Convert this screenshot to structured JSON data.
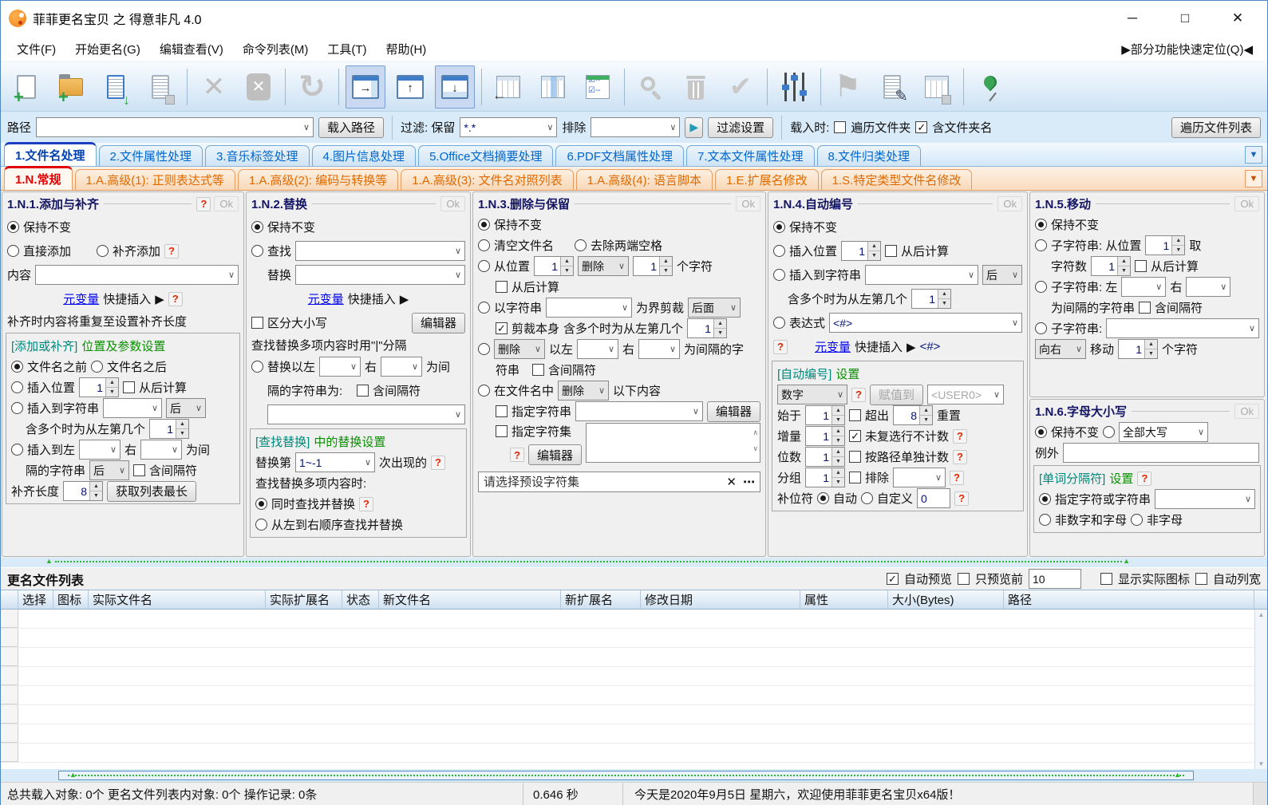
{
  "ui": {
    "q": "?",
    "ok": "Ok",
    "arrow": "▶",
    "x": "✕",
    "dots": "⋯",
    "play": "▶"
  },
  "window": {
    "title": "菲菲更名宝贝 之 得意非凡 4.0",
    "min": "─",
    "max": "□",
    "close": "✕"
  },
  "menu": {
    "items": [
      "文件(F)",
      "开始更名(G)",
      "编辑查看(V)",
      "命令列表(M)",
      "工具(T)",
      "帮助(H)"
    ],
    "quick": "▶部分功能快速定位(Q)◀"
  },
  "toolbar": {
    "groups": [
      [
        {
          "n": "add-files-icon",
          "t": "file-plus"
        },
        {
          "n": "add-folder-icon",
          "t": "folder-plus"
        },
        {
          "n": "load-list-icon",
          "t": "list-down"
        },
        {
          "n": "save-list-icon",
          "t": "list-save"
        }
      ],
      [
        {
          "n": "remove-item-icon",
          "t": "x"
        },
        {
          "n": "clear-list-icon",
          "t": "x-box"
        }
      ],
      [
        {
          "n": "refresh-icon",
          "t": "refresh"
        }
      ],
      [
        {
          "n": "panel-right-icon",
          "t": "panel-right",
          "sel": true
        },
        {
          "n": "panel-up-icon",
          "t": "panel-up"
        },
        {
          "n": "panel-down-icon",
          "t": "panel-down",
          "sel": true
        }
      ],
      [
        {
          "n": "layout-left-icon",
          "t": "grid-left"
        },
        {
          "n": "layout-columns-icon",
          "t": "grid-cols"
        },
        {
          "n": "layout-checklist-icon",
          "t": "grid-check"
        }
      ],
      [
        {
          "n": "search-icon",
          "t": "search"
        },
        {
          "n": "trash-icon",
          "t": "trash"
        },
        {
          "n": "apply-check-icon",
          "t": "check"
        }
      ],
      [
        {
          "n": "settings-sliders-icon",
          "t": "sliders"
        }
      ],
      [
        {
          "n": "flag-icon",
          "t": "flag"
        },
        {
          "n": "edit-list-icon",
          "t": "edit-list"
        },
        {
          "n": "export-table-icon",
          "t": "grid-save"
        }
      ],
      [
        {
          "n": "pin-icon",
          "t": "pin"
        }
      ]
    ]
  },
  "pathbar": {
    "path": "路径",
    "load": "载入路径",
    "filter": "过滤: 保留",
    "filter_val": "*.*",
    "excl": "排除",
    "settings": "过滤设置",
    "load_when": "载入时:",
    "traverse": "遍历文件夹",
    "incl_folder": "含文件夹名",
    "traverse_list": "遍历文件列表"
  },
  "tabs_main": {
    "active": 0,
    "items": [
      "1.文件名处理",
      "2.文件属性处理",
      "3.音乐标签处理",
      "4.图片信息处理",
      "5.Office文档摘要处理",
      "6.PDF文档属性处理",
      "7.文本文件属性处理",
      "8.文件归类处理"
    ]
  },
  "tabs_sub": {
    "active": 0,
    "items": [
      "1.N.常规",
      "1.A.高级(1): 正则表达式等",
      "1.A.高级(2): 编码与转换等",
      "1.A.高级(3): 文件名对照列表",
      "1.A.高级(4): 语言脚本",
      "1.E.扩展名修改",
      "1.S.特定类型文件名修改"
    ]
  },
  "p1": {
    "title": "1.N.1.添加与补齐",
    "keep": "保持不变",
    "direct_add": "直接添加",
    "pad_add": "补齐添加",
    "content": "内容",
    "meta": "元变量",
    "quick": "快捷插入",
    "note": "补齐时内容将重复至设置补齐长度",
    "group_b": "[添加或补齐]",
    "group_t": "位置及参数设置",
    "before_name": "文件名之前",
    "after_name": "文件名之后",
    "insert_pos": "插入位置",
    "pos_val": "1",
    "from_end": "从后计算",
    "insert_to_str": "插入到字符串",
    "after_opt": "后",
    "multi_hint": "含多个时为从左第几个",
    "multi_val": "1",
    "insert_l": "插入到左",
    "right": "右",
    "wei_jian": "为间",
    "sep_str": "隔的字符串",
    "incl_sep": "含间隔符",
    "pad_len": "补齐长度",
    "pad_val": "8",
    "get_longest": "获取列表最长"
  },
  "p2": {
    "title": "1.N.2.替换",
    "keep": "保持不变",
    "find": "查找",
    "replace": "替换",
    "meta": "元变量",
    "quick": "快捷插入",
    "case_sensitive": "区分大小写",
    "editor": "编辑器",
    "multi_note": "查找替换多项内容时用\"|\"分隔",
    "repl_l": "替换以左",
    "right": "右",
    "wei_jian": "为间",
    "sep_line": "隔的字符串为:",
    "incl_sep": "含间隔符",
    "group_b": "[查找替换]",
    "group_t": "中的替换设置",
    "nth": "替换第",
    "nth_val": "1~-1",
    "nth_suf": "次出现的",
    "multi_when": "查找替换多项内容时:",
    "simul": "同时查找并替换",
    "seq": "从左到右顺序查找并替换"
  },
  "p3": {
    "title": "1.N.3.删除与保留",
    "keep": "保持不变",
    "clear_name": "清空文件名",
    "trim": "去除两端空格",
    "from_pos": "从位置",
    "pos_val": "1",
    "del_opt": "删除",
    "cnt_val": "1",
    "chars": "个字符",
    "from_end": "从后计算",
    "by_str": "以字符串",
    "bound": "为界剪裁",
    "back_opt": "后面",
    "cut_self": "剪裁本身",
    "multi_hint": "含多个时为从左第几个",
    "multi_val": "1",
    "del_opt2": "删除",
    "between_l": "以左",
    "right": "右",
    "sep_suf": "为间隔的字",
    "str_cont": "符串",
    "incl_sep": "含间隔符",
    "in_name": "在文件名中",
    "del_opt3": "删除",
    "following": "以下内容",
    "spec_str": "指定字符串",
    "editor": "编辑器",
    "spec_set": "指定字符集",
    "editor2": "编辑器",
    "preset": "请选择预设字符集"
  },
  "p4": {
    "title": "1.N.4.自动编号",
    "keep": "保持不变",
    "insert_pos": "插入位置",
    "pos_val": "1",
    "from_end": "从后计算",
    "insert_to_str": "插入到字符串",
    "after_opt": "后",
    "multi_hint": "含多个时为从左第几个",
    "multi_val": "1",
    "expr": "表达式",
    "expr_val": "<#>",
    "meta": "元变量",
    "quick": "快捷插入",
    "tag": "<#>",
    "group_b": "[自动编号]",
    "group_t": "设置",
    "type_val": "数字",
    "assign": "赋值到",
    "user_val": "<USER0>",
    "start": "始于",
    "start_val": "1",
    "over": "超出",
    "over_val": "8",
    "reset": "重置",
    "step": "增量",
    "step_val": "1",
    "skip": "未复选行不计数",
    "digits": "位数",
    "digits_val": "1",
    "per_path": "按路径单独计数",
    "grp": "分组",
    "grp_val": "1",
    "excl": "排除",
    "pad_char": "补位符",
    "auto": "自动",
    "custom": "自定义",
    "custom_val": "0"
  },
  "p5": {
    "title": "1.N.5.移动",
    "keep": "保持不变",
    "sub1": "子字符串: 从位置",
    "pos_val": "1",
    "take": "取",
    "cnt": "字符数",
    "cnt_val": "1",
    "from_end": "从后计算",
    "sub2": "子字符串: 左",
    "right": "右",
    "sep_line": "为间隔的字符串",
    "incl_sep": "含间隔符",
    "sub3": "子字符串:",
    "dir": "向右",
    "move": "移动",
    "move_val": "1",
    "chars": "个字符"
  },
  "p6": {
    "title": "1.N.6.字母大小写",
    "keep": "保持不变",
    "case_val": "全部大写",
    "except": "例外",
    "group_b": "[单词分隔符]",
    "group_t": "设置",
    "spec": "指定字符或字符串",
    "non_alnum": "非数字和字母",
    "non_alpha": "非字母"
  },
  "preview": {
    "title": "更名文件列表",
    "auto": "自动预览",
    "first": "只预览前",
    "count": "10",
    "icons": "显示实际图标",
    "width": "自动列宽"
  },
  "table": {
    "columns": [
      "选择",
      "图标",
      "实际文件名",
      "实际扩展名",
      "状态",
      "新文件名",
      "新扩展名",
      "修改日期",
      "属性",
      "大小(Bytes)",
      "路径"
    ]
  },
  "status": {
    "loaded": "总共载入对象: 0个  更名文件列表内对象: 0个  操作记录: 0条",
    "time": "0.646 秒",
    "message": "今天是2020年9月5日 星期六，欢迎使用菲菲更名宝贝x64版！"
  }
}
